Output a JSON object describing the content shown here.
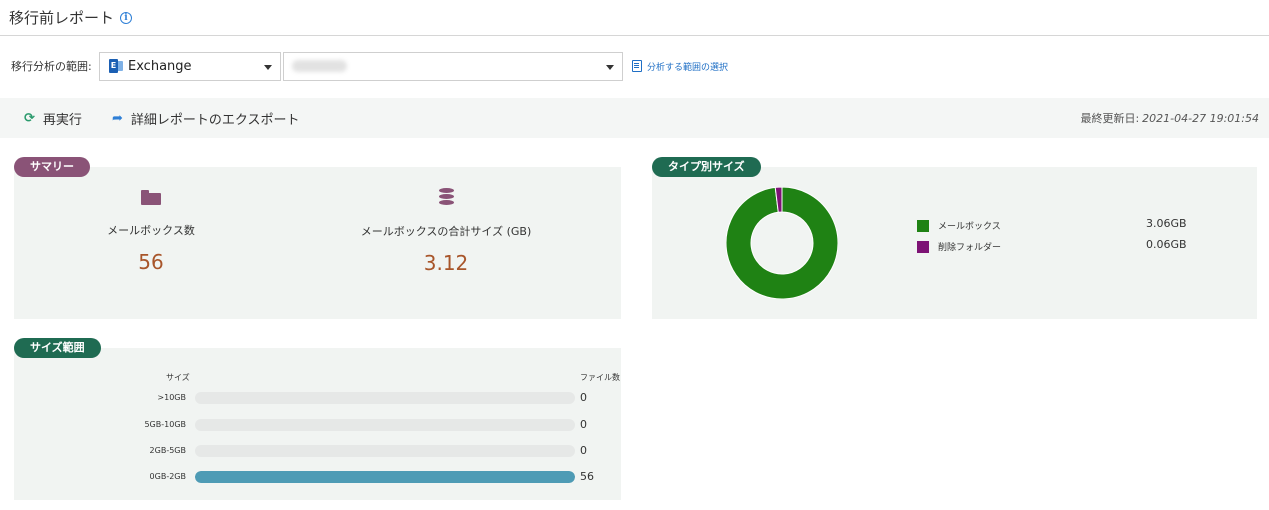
{
  "page": {
    "title": "移行前レポート"
  },
  "scope": {
    "label": "移行分析の範囲:",
    "product_value": "Exchange",
    "select_scope_link": "分析する範囲の選択"
  },
  "toolbar": {
    "rerun_label": "再実行",
    "export_label": "詳細レポートのエクスポート",
    "last_updated_label": "最終更新日:",
    "last_updated_value": "2021-04-27 19:01:54"
  },
  "summary": {
    "tag": "サマリー",
    "mailbox_count_label": "メールボックス数",
    "mailbox_count_value": "56",
    "total_size_label": "メールボックスの合計サイズ (GB)",
    "total_size_value": "3.12"
  },
  "type_size": {
    "tag": "タイプ別サイズ",
    "legend": [
      {
        "name": "メールボックス",
        "value_label": "3.06GB",
        "color": "#1f8214"
      },
      {
        "name": "削除フォルダー",
        "value_label": "0.06GB",
        "color": "#7d1375"
      }
    ]
  },
  "size_range": {
    "tag": "サイズ範囲",
    "size_header": "サイズ",
    "count_header": "ファイル数",
    "rows": [
      {
        "label": ">10GB",
        "value": "0"
      },
      {
        "label": "5GB-10GB",
        "value": "0"
      },
      {
        "label": "2GB-5GB",
        "value": "0"
      },
      {
        "label": "0GB-2GB",
        "value": "56"
      }
    ]
  },
  "chart_data": [
    {
      "type": "pie",
      "categories": [
        "メールボックス",
        "削除フォルダー"
      ],
      "values": [
        3.06,
        0.06
      ],
      "colors": [
        "#1f8214",
        "#7d1375"
      ],
      "donut": true,
      "legend": "right"
    },
    {
      "type": "bar",
      "orientation": "horizontal",
      "categories": [
        ">10GB",
        "5GB-10GB",
        "2GB-5GB",
        "0GB-2GB"
      ],
      "values": [
        0,
        0,
        0,
        56
      ],
      "xlabel": "ファイル数",
      "ylabel": "サイズ",
      "xlim": [
        0,
        56
      ],
      "color": "#4e9bb5"
    }
  ]
}
